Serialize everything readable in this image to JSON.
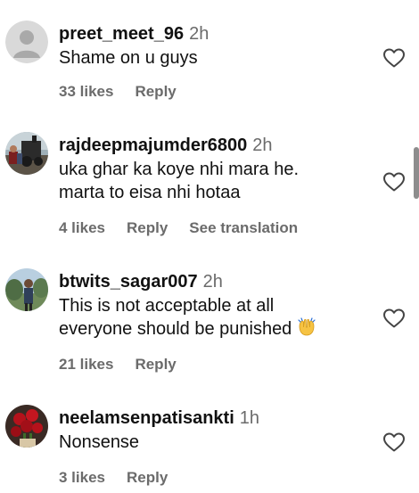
{
  "comments": [
    {
      "username": "preet_meet_96",
      "time": "2h",
      "text_lines": [
        "Shame on u guys"
      ],
      "likes": "33 likes",
      "reply": "Reply",
      "translation": "",
      "avatar": "default-avatar-icon"
    },
    {
      "username": "rajdeepmajumder6800",
      "time": "2h",
      "text_lines": [
        "uka ghar ka koye nhi mara he.",
        "marta to eisa nhi hotaa"
      ],
      "likes": "4 likes",
      "reply": "Reply",
      "translation": "See translation",
      "avatar": "train-photo-avatar"
    },
    {
      "username": "btwits_sagar007",
      "time": "2h",
      "text_lines": [
        "This is not acceptable at all",
        "everyone should be punished"
      ],
      "emoji": "raising-hands-emoji",
      "likes": "21 likes",
      "reply": "Reply",
      "translation": "",
      "avatar": "outdoor-photo-avatar"
    },
    {
      "username": "neelamsenpatisankti",
      "time": "1h",
      "text_lines": [
        "Nonsense"
      ],
      "likes": "3 likes",
      "reply": "Reply",
      "translation": "",
      "avatar": "roses-photo-avatar"
    }
  ],
  "colors": {
    "text": "#111111",
    "muted": "#6b6b6b",
    "heart_stroke": "#444444"
  },
  "icons": {
    "like": "heart-outline-icon"
  }
}
